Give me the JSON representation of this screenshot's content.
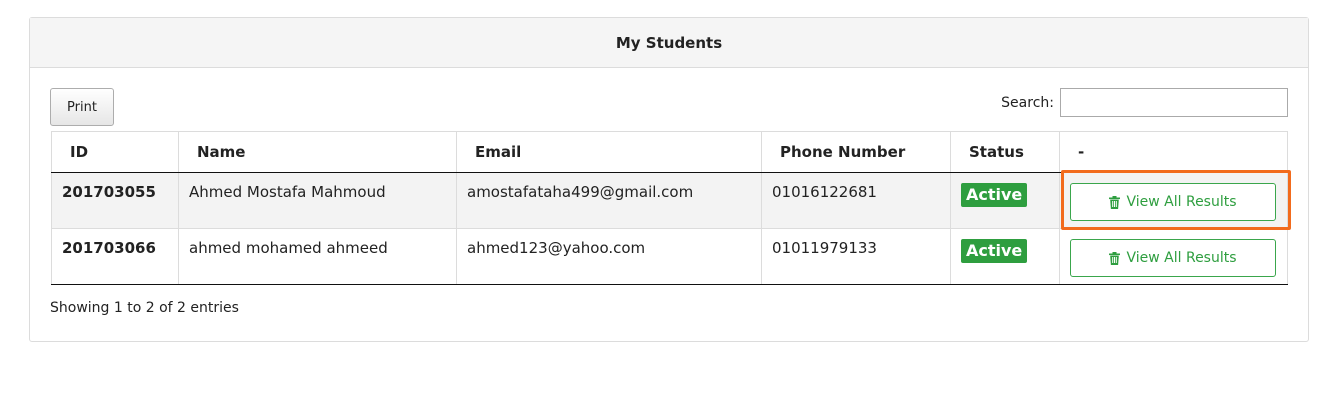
{
  "panel": {
    "title": "My Students"
  },
  "toolbar": {
    "print_label": "Print",
    "search_label": "Search:",
    "search_value": ""
  },
  "table": {
    "columns": [
      "ID",
      "Name",
      "Email",
      "Phone Number",
      "Status",
      "-"
    ],
    "rows": [
      {
        "id": "201703055",
        "name": "Ahmed Mostafa Mahmoud",
        "email": "amostafataha499@gmail.com",
        "phone": "01016122681",
        "status": "Active",
        "action": "View All Results"
      },
      {
        "id": "201703066",
        "name": "ahmed mohamed ahmeed",
        "email": "ahmed123@yahoo.com",
        "phone": "01011979133",
        "status": "Active",
        "action": "View All Results"
      }
    ]
  },
  "footer": {
    "info": "Showing 1 to 2 of 2 entries"
  },
  "icons": {
    "action_icon": "trash-icon"
  },
  "colors": {
    "status_active": "#2e9e3f",
    "action_button": "#2e9e3f",
    "highlight": "#f26b1d"
  }
}
